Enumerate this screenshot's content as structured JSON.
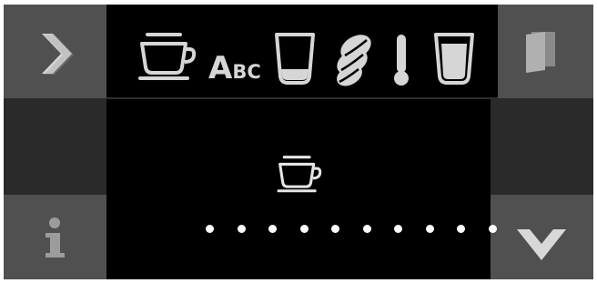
{
  "left_panel": {
    "next_icon": "chevron-right-icon",
    "info_icon": "info-icon"
  },
  "right_panel": {
    "exit_icon": "door-icon",
    "confirm_icon": "chevron-down-icon"
  },
  "top_bar": {
    "icons": [
      "cup-icon",
      "abc-name-icon",
      "glass-volume-icon",
      "coffee-beans-icon",
      "thermometer-icon",
      "glass-full-icon"
    ],
    "abc_big": "A",
    "abc_small": "BC"
  },
  "center": {
    "selected_icon": "cup-icon"
  },
  "progress": {
    "dot_count": 10
  },
  "colors": {
    "background": "#000000",
    "button_light": "#505050",
    "button_dark": "#2a2a2a",
    "icon_light": "#d6d6d6"
  }
}
